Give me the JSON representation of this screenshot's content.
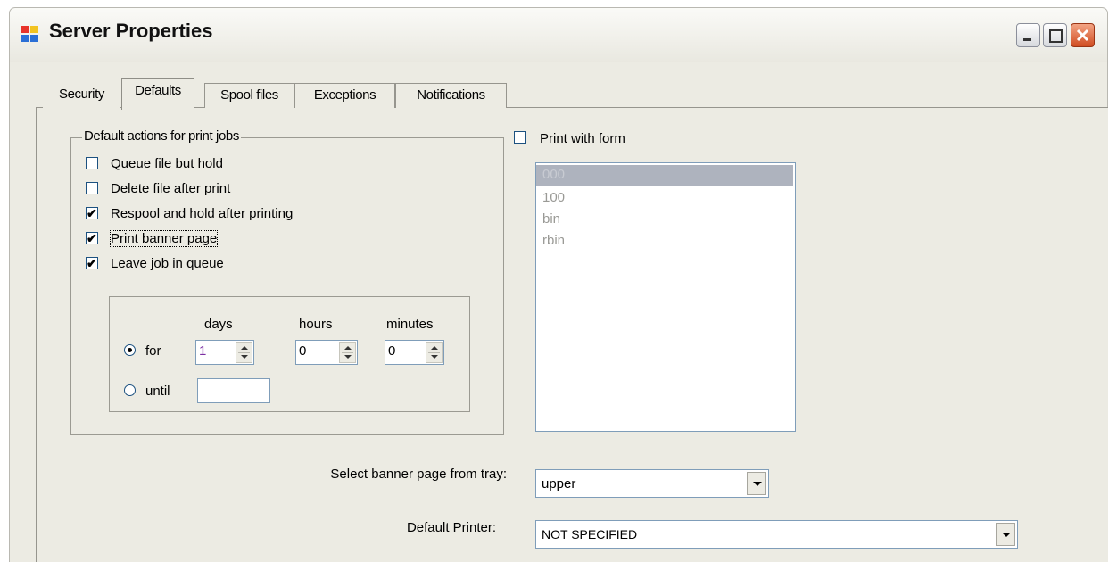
{
  "window": {
    "title": "Server Properties"
  },
  "tabs": [
    {
      "label": "Security"
    },
    {
      "label": "Defaults"
    },
    {
      "label": "Spool files"
    },
    {
      "label": "Exceptions"
    },
    {
      "label": "Notifications"
    }
  ],
  "default_actions": {
    "title": "Default actions for print jobs",
    "options": [
      {
        "label": "Queue file but hold",
        "checked": false
      },
      {
        "label": "Delete file after print",
        "checked": false
      },
      {
        "label": "Respool and hold after printing",
        "checked": true
      },
      {
        "label": "Print banner page",
        "checked": true
      },
      {
        "label": "Leave job in queue",
        "checked": true
      }
    ]
  },
  "retention": {
    "days_label": "days",
    "hours_label": "hours",
    "minutes_label": "minutes",
    "for_label": "for",
    "until_label": "until",
    "days_value": "1",
    "hours_value": "0",
    "minutes_value": "0",
    "until_value": ""
  },
  "print_with_form": {
    "label": "Print with form",
    "checked": false,
    "forms": [
      "000",
      "100",
      "bin",
      "rbin"
    ]
  },
  "banner_tray": {
    "label": "Select banner page from tray:",
    "value": "upper"
  },
  "default_printer": {
    "label": "Default Printer:",
    "value": "NOT SPECIFIED"
  }
}
